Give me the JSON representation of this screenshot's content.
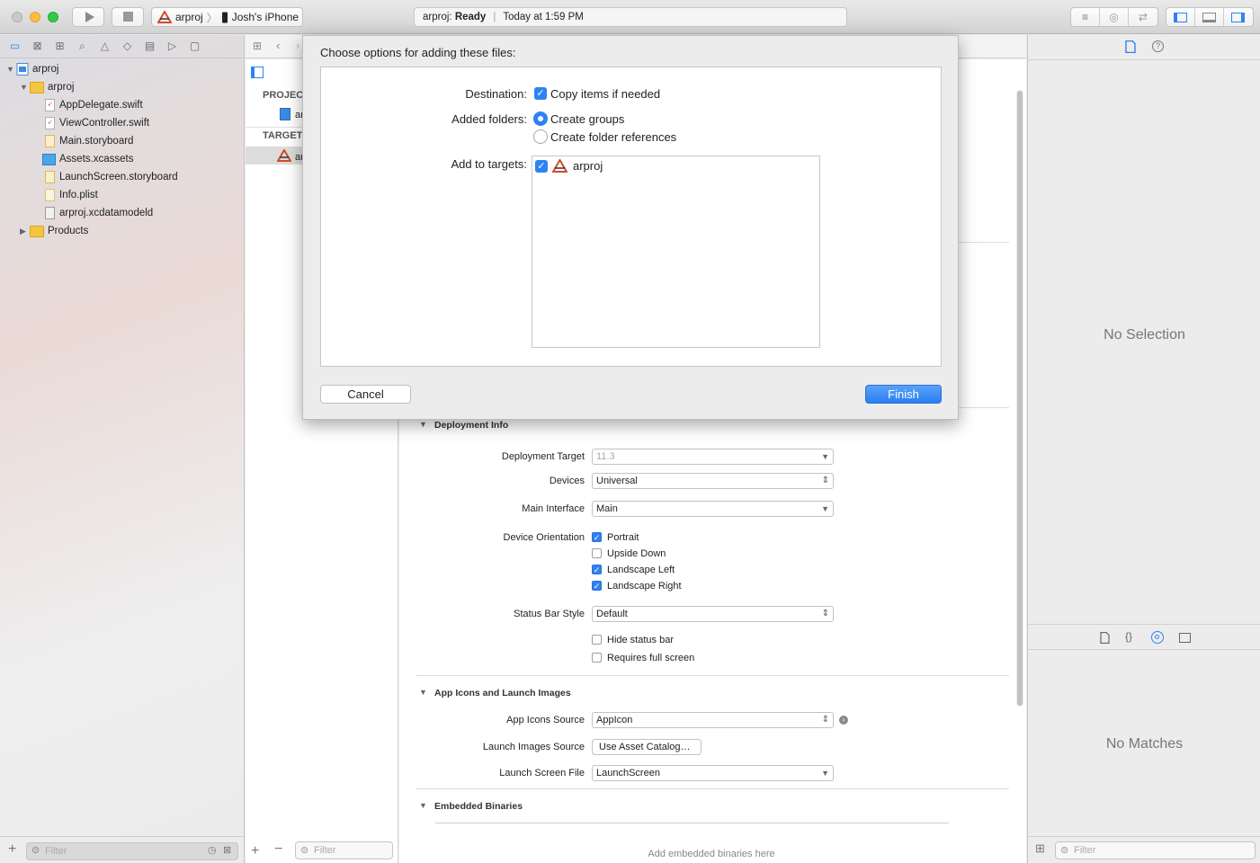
{
  "toolbar": {
    "scheme_project": "arproj",
    "scheme_device": "Josh's iPhone",
    "activity_project": "arproj:",
    "activity_status": "Ready",
    "activity_time": "Today at 1:59 PM"
  },
  "navigator": {
    "items": [
      {
        "label": "arproj",
        "level": 0,
        "kind": "project",
        "expanded": true
      },
      {
        "label": "arproj",
        "level": 1,
        "kind": "folder",
        "expanded": true
      },
      {
        "label": "AppDelegate.swift",
        "level": 2,
        "kind": "swift"
      },
      {
        "label": "ViewController.swift",
        "level": 2,
        "kind": "swift"
      },
      {
        "label": "Main.storyboard",
        "level": 2,
        "kind": "storyboard"
      },
      {
        "label": "Assets.xcassets",
        "level": 2,
        "kind": "assets"
      },
      {
        "label": "LaunchScreen.storyboard",
        "level": 2,
        "kind": "storyboard"
      },
      {
        "label": "Info.plist",
        "level": 2,
        "kind": "plist"
      },
      {
        "label": "arproj.xcdatamodeld",
        "level": 2,
        "kind": "datamodel"
      },
      {
        "label": "Products",
        "level": 1,
        "kind": "folder",
        "expanded": false
      }
    ],
    "filter_placeholder": "Filter"
  },
  "project_list": {
    "project_header": "PROJEC",
    "project_item": "ar",
    "targets_header": "TARGET",
    "target_item": "ar",
    "filter_placeholder": "Filter"
  },
  "sheet": {
    "title": "Choose options for adding these files:",
    "destination_label": "Destination:",
    "copy_items_label": "Copy items if needed",
    "copy_items_checked": true,
    "added_folders_label": "Added folders:",
    "create_groups_label": "Create groups",
    "create_folder_refs_label": "Create folder references",
    "selected_folder_option": "Create groups",
    "add_to_targets_label": "Add to targets:",
    "target_name": "arproj",
    "target_checked": true,
    "cancel_label": "Cancel",
    "finish_label": "Finish"
  },
  "deployment": {
    "section_title": "Deployment Info",
    "deployment_target_label": "Deployment Target",
    "deployment_target_value": "11.3",
    "devices_label": "Devices",
    "devices_value": "Universal",
    "main_interface_label": "Main Interface",
    "main_interface_value": "Main",
    "orientation_label": "Device Orientation",
    "orientations": [
      {
        "label": "Portrait",
        "checked": true
      },
      {
        "label": "Upside Down",
        "checked": false
      },
      {
        "label": "Landscape Left",
        "checked": true
      },
      {
        "label": "Landscape Right",
        "checked": true
      }
    ],
    "status_bar_label": "Status Bar Style",
    "status_bar_value": "Default",
    "hide_status_bar_label": "Hide status bar",
    "hide_status_bar_checked": false,
    "requires_full_screen_label": "Requires full screen",
    "requires_full_screen_checked": false
  },
  "app_icons": {
    "section_title": "App Icons and Launch Images",
    "icons_source_label": "App Icons Source",
    "icons_source_value": "AppIcon",
    "launch_images_label": "Launch Images Source",
    "launch_images_button": "Use Asset Catalog…",
    "launch_screen_label": "Launch Screen File",
    "launch_screen_value": "LaunchScreen"
  },
  "embedded": {
    "section_title": "Embedded Binaries",
    "placeholder": "Add embedded binaries here"
  },
  "inspector": {
    "no_selection": "No Selection",
    "no_matches": "No Matches",
    "filter_placeholder": "Filter"
  },
  "colors": {
    "accent": "#2e82f3",
    "finish_button": "#3a8ef6"
  }
}
